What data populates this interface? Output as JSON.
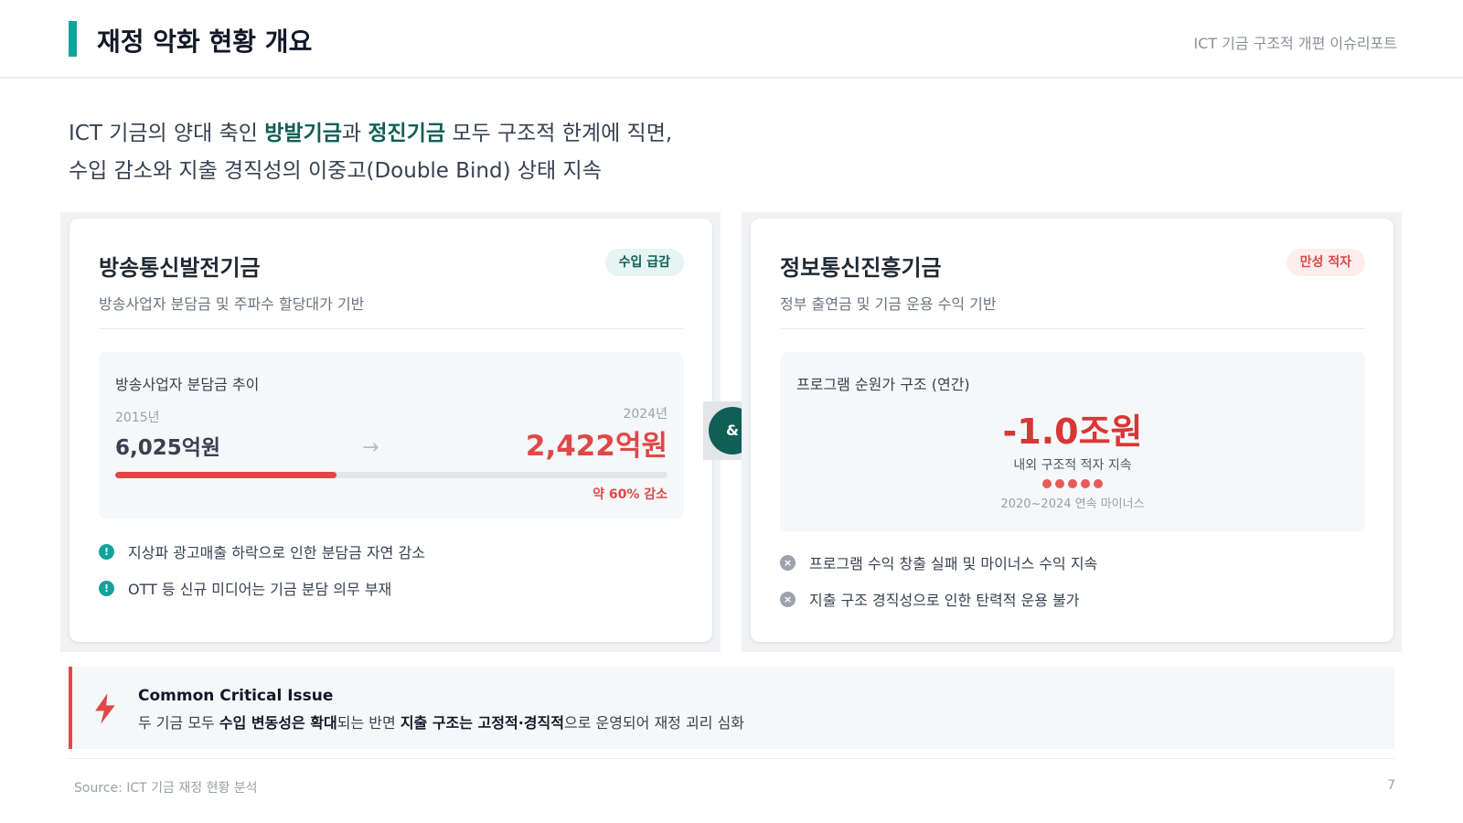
{
  "header": {
    "title": "재정 악화 현황 개요",
    "report_name": "ICT 기금 구조적 개편 이슈리포트"
  },
  "lead": {
    "line1_pre": "ICT 기금의 양대 축인 ",
    "fund_a": "방발기금",
    "line1_mid": "과 ",
    "fund_b": "정진기금",
    "line1_post": " 모두 구조적 한계에 직면,",
    "line2": "수입 감소와 지출 경직성의 이중고(Double Bind) 상태 지속"
  },
  "left_card": {
    "title": "방송통신발전기금",
    "badge": "수입 급감",
    "subtitle": "방송사업자 분담금 및 주파수 할당대가 기반",
    "trend": {
      "title": "방송사업자 분담금 추이",
      "from_year": "2015년",
      "from_value": "6,025억원",
      "to_year": "2024년",
      "to_value": "2,422억원",
      "bar_ratio_percent": 40,
      "change_note": "약 60% 감소"
    },
    "bullets": [
      {
        "icon": "alert-icon",
        "icon_glyph": "!",
        "text": "지상파 광고매출 하락으로 인한 분담금 자연 감소"
      },
      {
        "icon": "alert-icon",
        "icon_glyph": "!",
        "text": "OTT 등 신규 미디어는 기금 분담 의무 부재"
      }
    ]
  },
  "connector": {
    "symbol": "&"
  },
  "right_card": {
    "title": "정보통신진흥기금",
    "badge": "만성 적자",
    "subtitle": "정부 출연금 및 기금 운용 수익 기반",
    "cost": {
      "title": "프로그램 순원가 구조 (연간)",
      "value": "-1.0조원",
      "note": "내외 구조적 적자 지속",
      "dot_count": 5,
      "period_note": "2020~2024 연속 마이너스"
    },
    "bullets": [
      {
        "icon": "x-circle-icon",
        "icon_glyph": "×",
        "text": "프로그램 수익 창출 실패 및 마이너스 수익 지속"
      },
      {
        "icon": "x-circle-icon",
        "icon_glyph": "×",
        "text": "지출 구조 경직성으로 인한 탄력적 운용 불가"
      }
    ]
  },
  "issue": {
    "icon": "lightning-icon",
    "title": "Common Critical Issue",
    "t1": "두 기금 모두 ",
    "b1": "수입 변동성은 확대",
    "t2": "되는 반면 ",
    "b2": "지출 구조는 고정적·경직적",
    "t3": "으로 운영되어 재정 괴리 심화"
  },
  "footer": {
    "source": "Source: ICT 기금 재정 현황 분석",
    "page": "7"
  },
  "colors": {
    "accent_teal": "#14a39a",
    "dark_teal": "#0f5f57",
    "alert_red": "#e04848"
  }
}
